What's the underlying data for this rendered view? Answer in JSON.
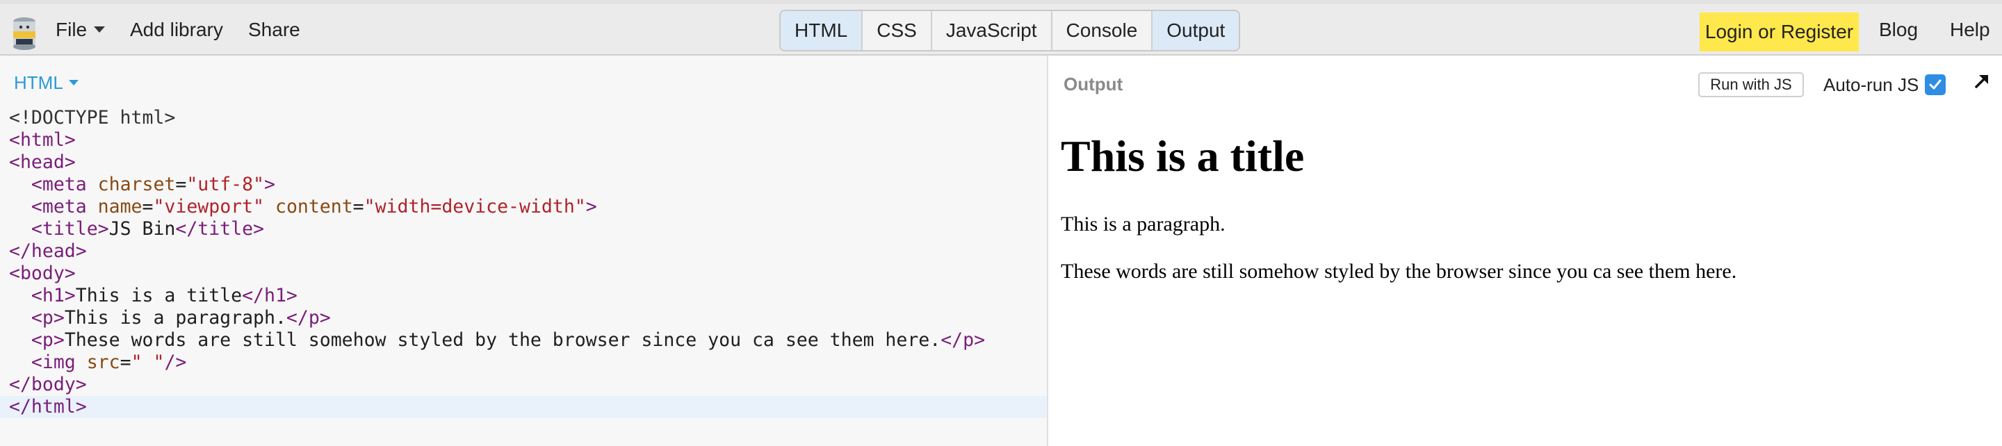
{
  "toolbar": {
    "file": "File",
    "add_library": "Add library",
    "share": "Share",
    "panels": [
      "HTML",
      "CSS",
      "JavaScript",
      "Console",
      "Output"
    ],
    "active_panels": [
      "HTML",
      "Output"
    ],
    "login": "Login or Register",
    "blog": "Blog",
    "help": "Help"
  },
  "editor": {
    "label": "HTML",
    "lines": [
      "<!DOCTYPE html>",
      "<html>",
      "<head>",
      "  <meta charset=\"utf-8\">",
      "  <meta name=\"viewport\" content=\"width=device-width\">",
      "  <title>JS Bin</title>",
      "</head>",
      "<body>",
      "  <h1>This is a title</h1>",
      "  <p>This is a paragraph.</p>",
      "  <p>These words are still somehow styled by the browser since you ca see them here.</p>",
      "  <img src=\" \"/>",
      "</body>",
      "</html>"
    ]
  },
  "output": {
    "label": "Output",
    "run_button": "Run with JS",
    "autorun_label": "Auto-run JS",
    "autorun_checked": true,
    "heading": "This is a title",
    "paragraph1": "This is a paragraph.",
    "paragraph2": "These words are still somehow styled by the browser since you ca see them here."
  },
  "colors": {
    "accent": "#2a9ad8",
    "login_bg": "#ffe84b",
    "active_panel_bg": "#dceaf7",
    "tag": "#7a1e7a",
    "attr": "#8a4a13",
    "string": "#b0232a"
  },
  "icons": {
    "logo": "jsbin-logo-icon",
    "checkbox": "checkmark-icon",
    "expand": "arrow-up-right-icon"
  }
}
